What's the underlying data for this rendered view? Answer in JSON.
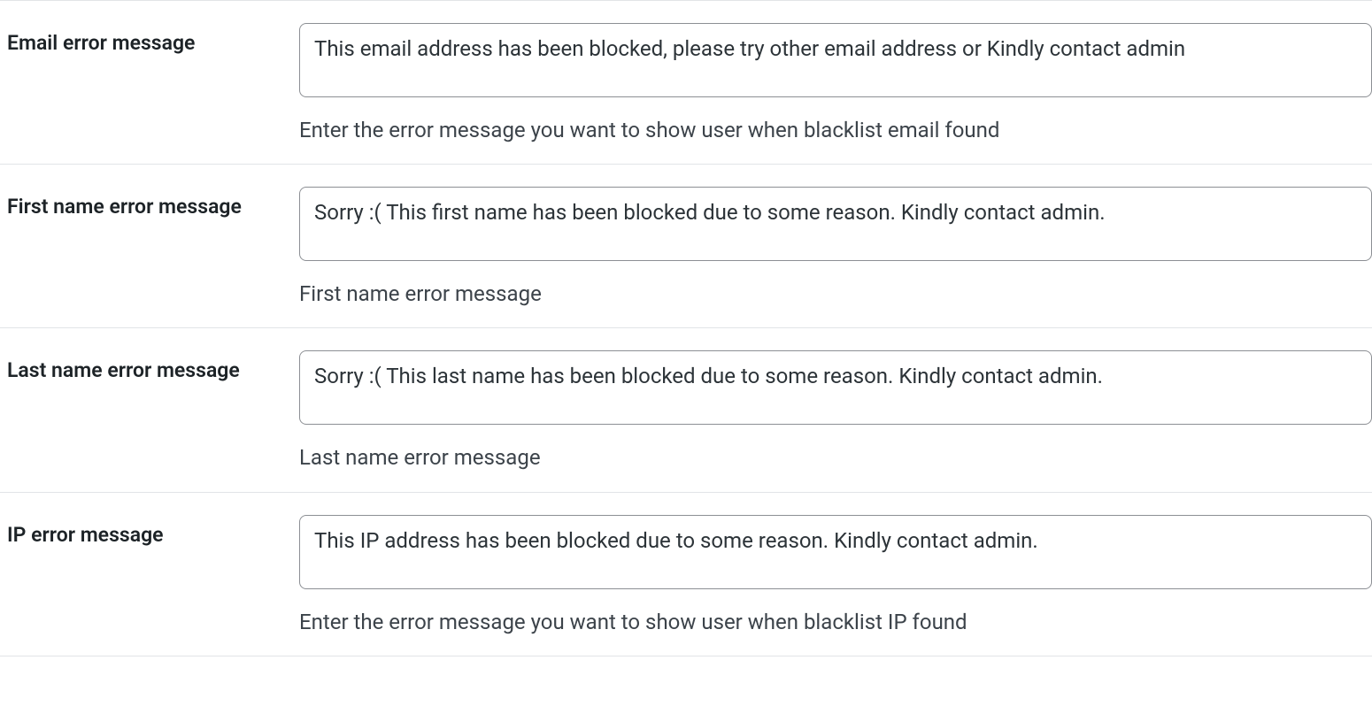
{
  "fields": {
    "email": {
      "label": "Email error message",
      "value": "This email address has been blocked, please try other email address or Kindly contact admin",
      "help": "Enter the error message you want to show user when blacklist email found"
    },
    "firstName": {
      "label": "First name error message",
      "value": "Sorry :( This first name has been blocked due to some reason. Kindly contact admin.",
      "help": "First name error message"
    },
    "lastName": {
      "label": "Last name error message",
      "value": "Sorry :( This last name has been blocked due to some reason. Kindly contact admin.",
      "help": "Last name error message"
    },
    "ip": {
      "label": "IP error message",
      "value": "This IP address has been blocked due to some reason. Kindly contact admin.",
      "help": "Enter the error message you want to show user when blacklist IP found"
    }
  }
}
